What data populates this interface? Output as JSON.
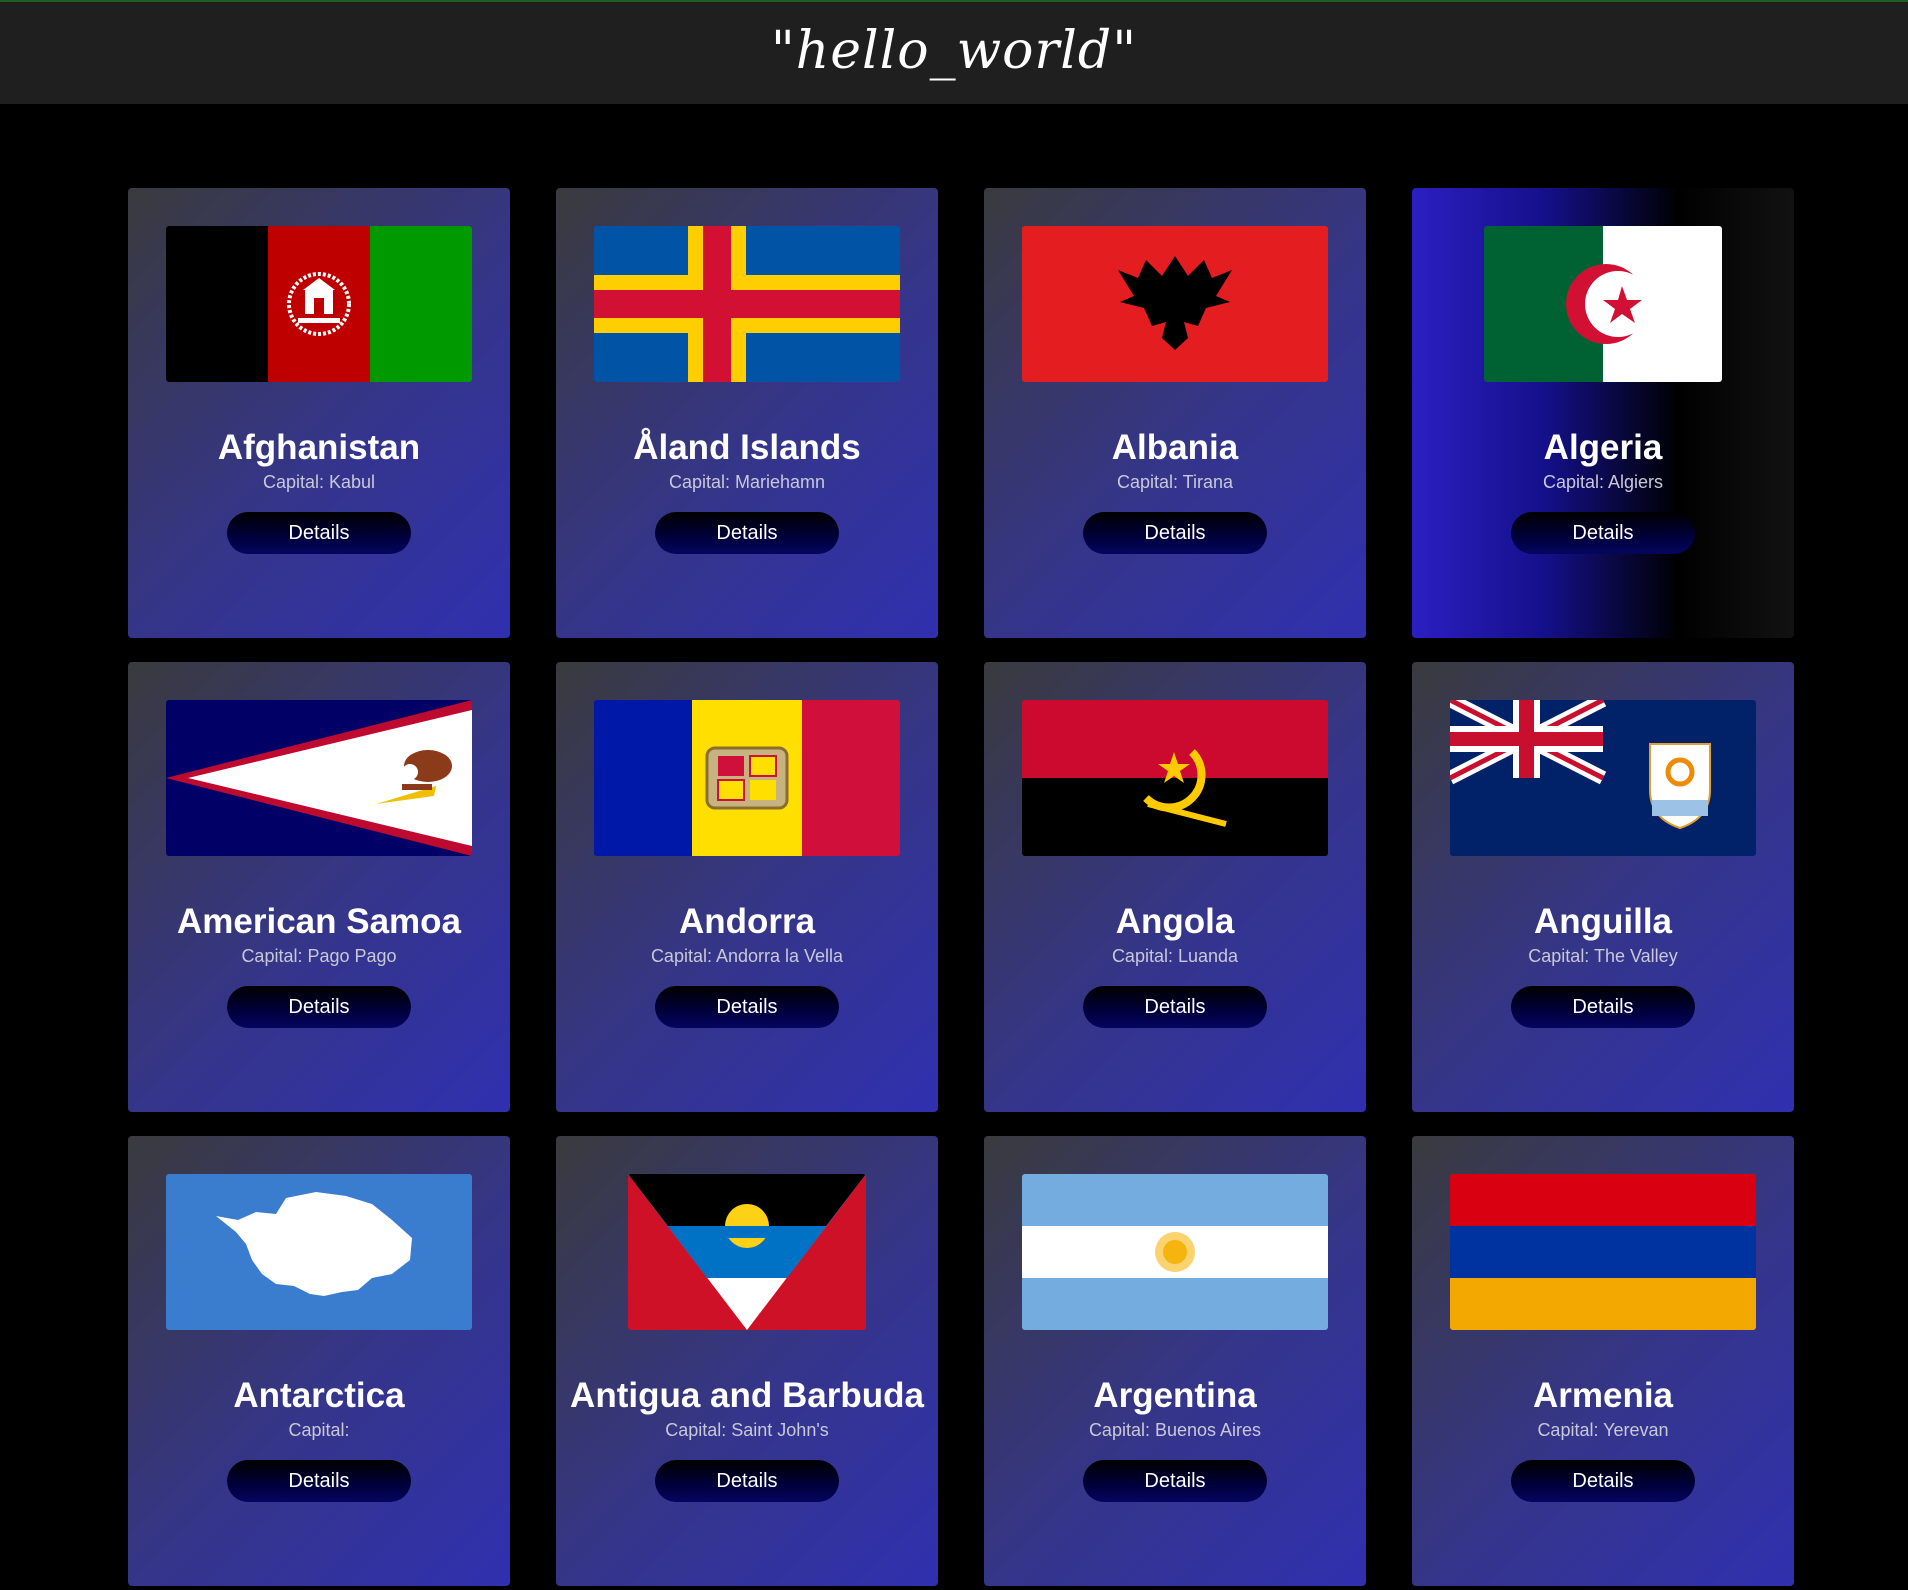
{
  "header": {
    "title": "\"hello_world\""
  },
  "colors": {
    "background": "#000000",
    "header_bg": "#1f1f1f",
    "card_gradient_start": "#3a3a3e",
    "card_gradient_end": "#3030b0",
    "button_bg": "#00003c",
    "text": "#ffffff",
    "subtext": "#c8c8d8"
  },
  "capital_prefix": "Capital:",
  "button_label": "Details",
  "countries": [
    {
      "name": "Afghanistan",
      "capital": "Capital: Kabul",
      "flag_icon": "afghanistan-flag-icon"
    },
    {
      "name": "Åland Islands",
      "capital": "Capital: Mariehamn",
      "flag_icon": "aland-islands-flag-icon"
    },
    {
      "name": "Albania",
      "capital": "Capital: Tirana",
      "flag_icon": "albania-flag-icon"
    },
    {
      "name": "Algeria",
      "capital": "Capital: Algiers",
      "flag_icon": "algeria-flag-icon",
      "highlighted": true
    },
    {
      "name": "American Samoa",
      "capital": "Capital: Pago Pago",
      "flag_icon": "american-samoa-flag-icon"
    },
    {
      "name": "Andorra",
      "capital": "Capital: Andorra la Vella",
      "flag_icon": "andorra-flag-icon"
    },
    {
      "name": "Angola",
      "capital": "Capital: Luanda",
      "flag_icon": "angola-flag-icon"
    },
    {
      "name": "Anguilla",
      "capital": "Capital: The Valley",
      "flag_icon": "anguilla-flag-icon"
    },
    {
      "name": "Antarctica",
      "capital": "Capital:",
      "flag_icon": "antarctica-flag-icon"
    },
    {
      "name": "Antigua and Barbuda",
      "capital": "Capital: Saint John's",
      "flag_icon": "antigua-and-barbuda-flag-icon"
    },
    {
      "name": "Argentina",
      "capital": "Capital: Buenos Aires",
      "flag_icon": "argentina-flag-icon"
    },
    {
      "name": "Armenia",
      "capital": "Capital: Yerevan",
      "flag_icon": "armenia-flag-icon"
    }
  ]
}
